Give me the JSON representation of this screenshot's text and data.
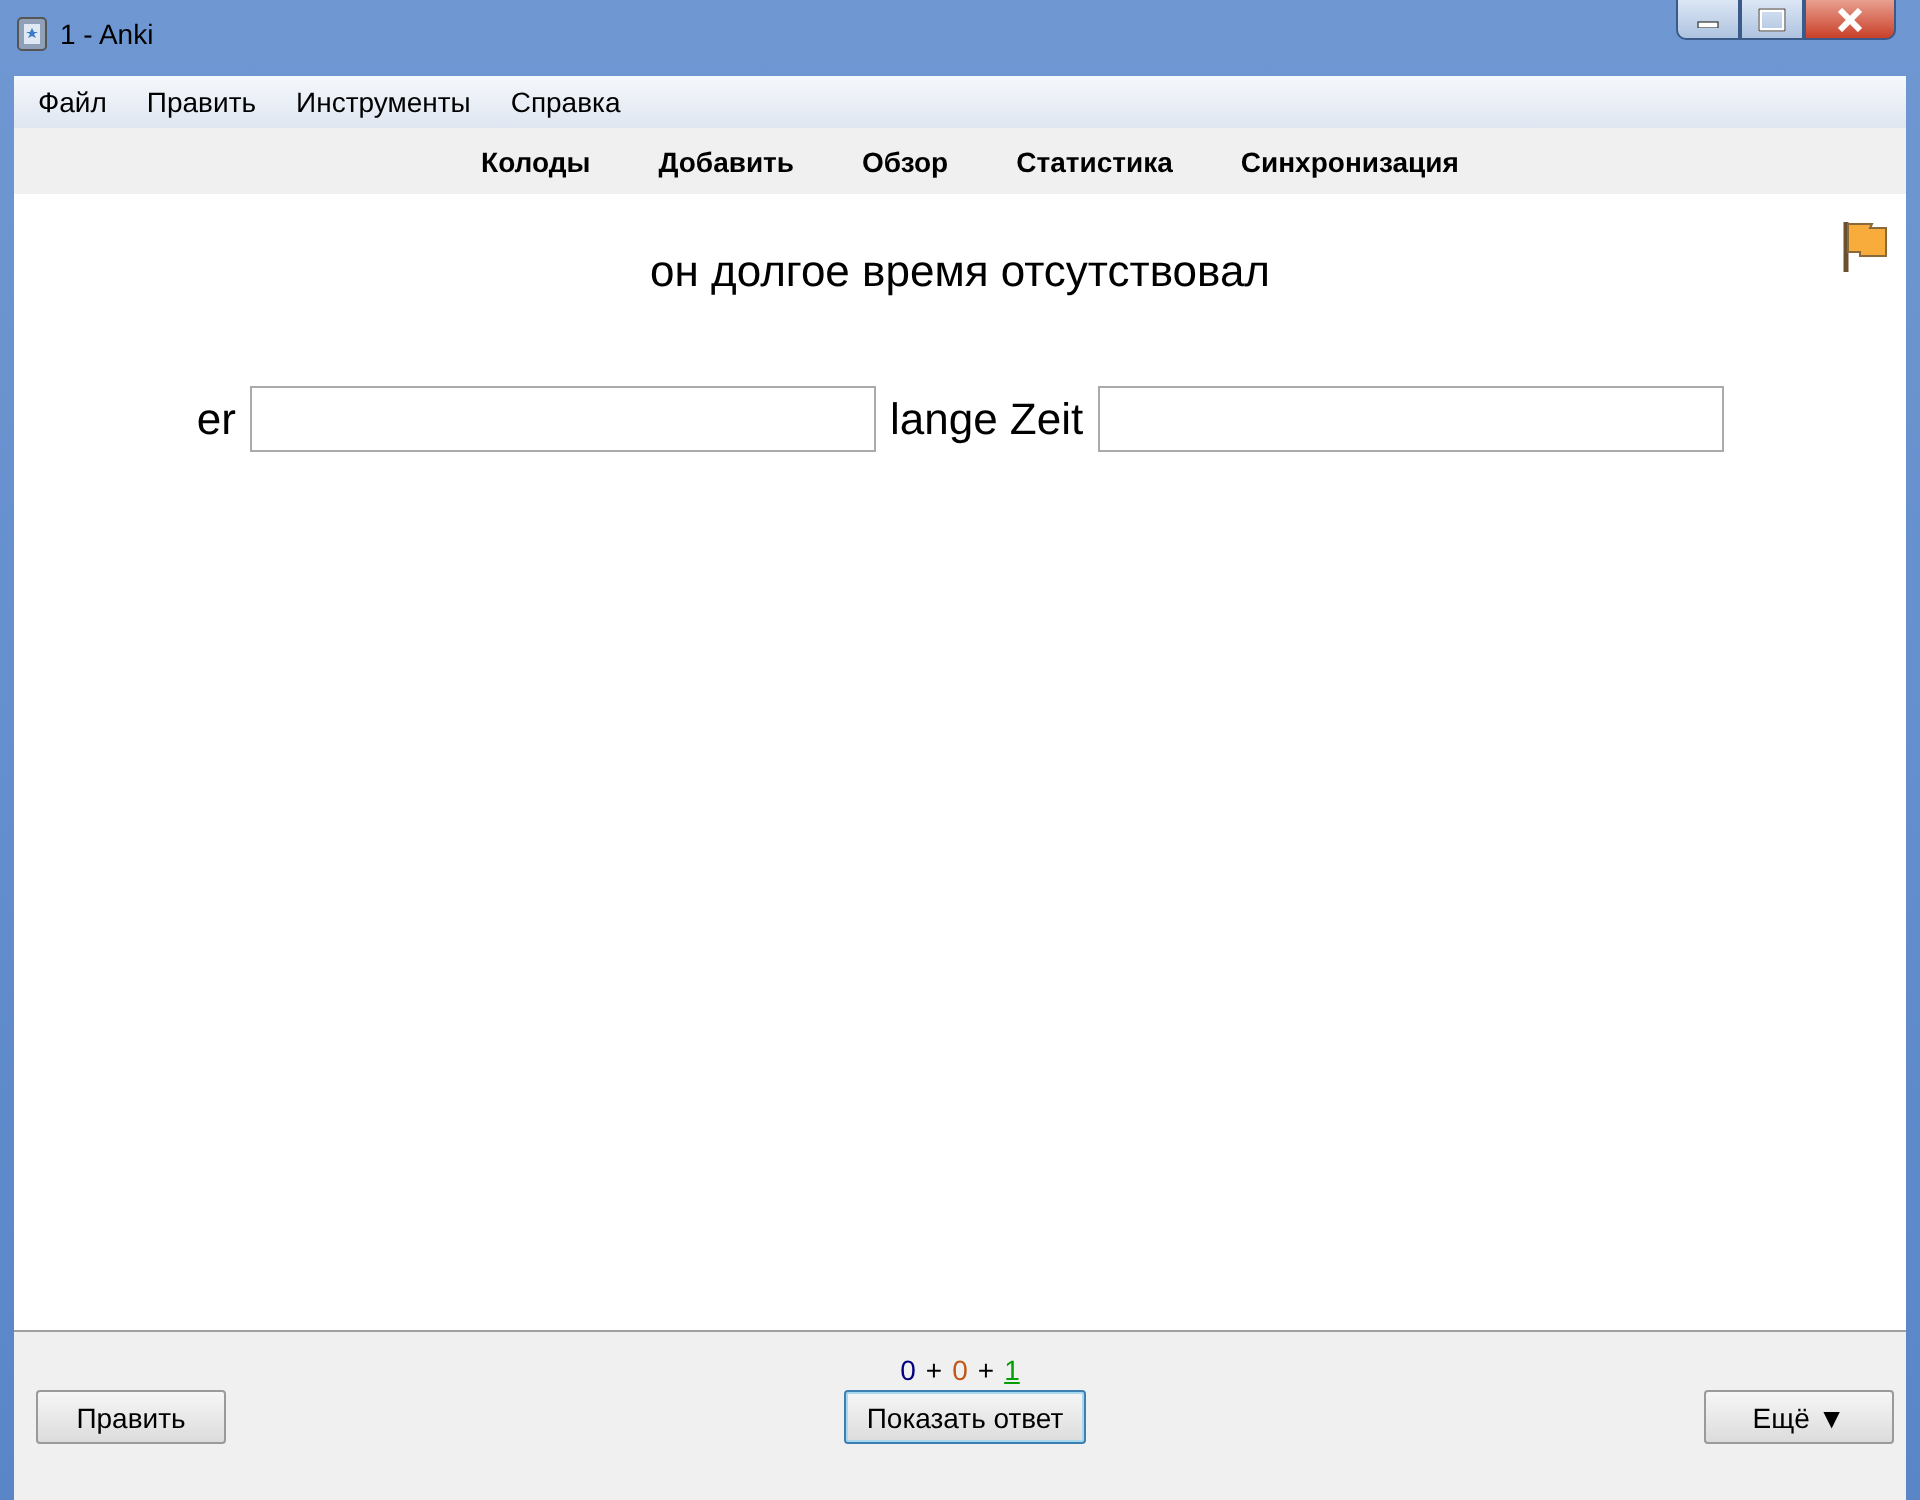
{
  "window": {
    "title": "1 - Anki"
  },
  "menu": [
    "Файл",
    "Править",
    "Инструменты",
    "Справка"
  ],
  "toolbar": [
    "Колоды",
    "Добавить",
    "Обзор",
    "Статистика",
    "Синхронизация"
  ],
  "card": {
    "flagged": true,
    "question": "он долгое время отсутствовал",
    "cloze": [
      {
        "kind": "text",
        "text": "er"
      },
      {
        "kind": "input"
      },
      {
        "kind": "text",
        "text": "lange Zeit"
      },
      {
        "kind": "input"
      }
    ]
  },
  "counts": [
    {
      "value": "0",
      "color": "#000080",
      "selected": false
    },
    {
      "value": "0",
      "color": "#c35617",
      "selected": false
    },
    {
      "value": "1",
      "color": "#00a000",
      "selected": true
    }
  ],
  "count_separators": [
    "+",
    "+"
  ],
  "buttons": {
    "edit": "Править",
    "show_answer": "Показать ответ",
    "more": "Ещё ▼"
  }
}
